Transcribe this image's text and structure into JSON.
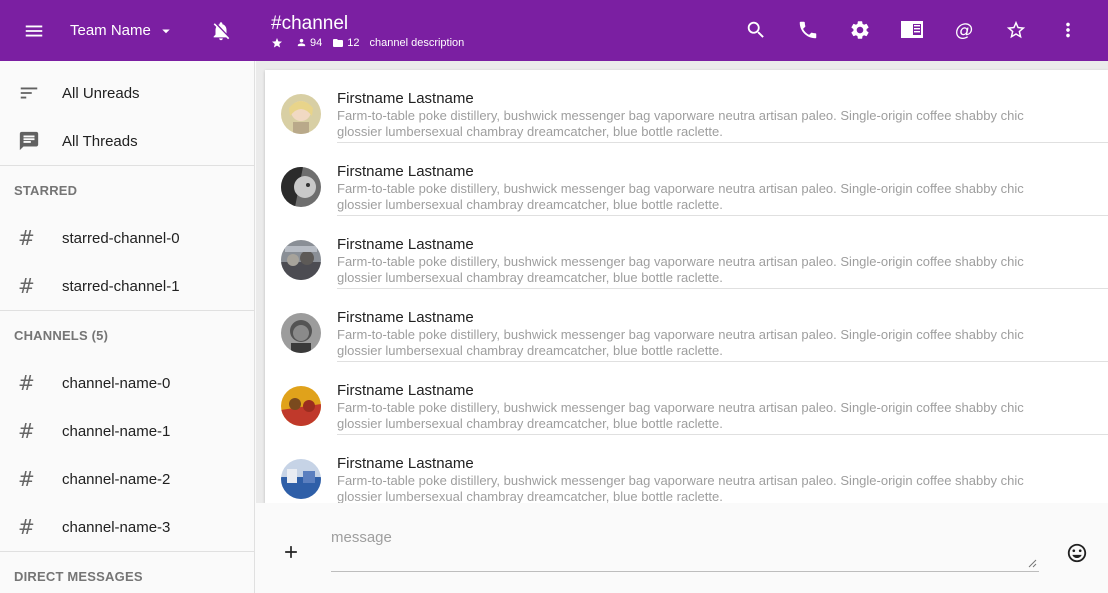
{
  "topbar": {
    "team_name": "Team Name",
    "channel_title": "#channel",
    "members_count": "94",
    "files_count": "12",
    "channel_description": "channel description",
    "actions": [
      "search-icon",
      "phone-icon",
      "settings-icon",
      "sidebar-panel-icon",
      "mention-icon",
      "star-outline-icon",
      "more-vert-icon"
    ]
  },
  "sidebar": {
    "top_items": [
      {
        "label": "All Unreads",
        "icon": "sort-icon"
      },
      {
        "label": "All Threads",
        "icon": "message-icon"
      }
    ],
    "starred_header": "STARRED",
    "starred": [
      "starred-channel-0",
      "starred-channel-1"
    ],
    "channels_header": "CHANNELS (5)",
    "channels": [
      "channel-name-0",
      "channel-name-1",
      "channel-name-2",
      "channel-name-3"
    ],
    "dm_header": "DIRECT MESSAGES"
  },
  "messages": [
    {
      "name": "Firstname Lastname",
      "text": "Farm-to-table poke distillery, bushwick messenger bag vaporware neutra artisan paleo. Single-origin coffee shabby chic glossier lumbersexual chambray dreamcatcher, blue bottle raclette."
    },
    {
      "name": "Firstname Lastname",
      "text": "Farm-to-table poke distillery, bushwick messenger bag vaporware neutra artisan paleo. Single-origin coffee shabby chic glossier lumbersexual chambray dreamcatcher, blue bottle raclette."
    },
    {
      "name": "Firstname Lastname",
      "text": "Farm-to-table poke distillery, bushwick messenger bag vaporware neutra artisan paleo. Single-origin coffee shabby chic glossier lumbersexual chambray dreamcatcher, blue bottle raclette."
    },
    {
      "name": "Firstname Lastname",
      "text": "Farm-to-table poke distillery, bushwick messenger bag vaporware neutra artisan paleo. Single-origin coffee shabby chic glossier lumbersexual chambray dreamcatcher, blue bottle raclette."
    },
    {
      "name": "Firstname Lastname",
      "text": "Farm-to-table poke distillery, bushwick messenger bag vaporware neutra artisan paleo. Single-origin coffee shabby chic glossier lumbersexual chambray dreamcatcher, blue bottle raclette."
    },
    {
      "name": "Firstname Lastname",
      "text": "Farm-to-table poke distillery, bushwick messenger bag vaporware neutra artisan paleo. Single-origin coffee shabby chic glossier lumbersexual chambray dreamcatcher, blue bottle raclette."
    }
  ],
  "composer": {
    "placeholder": "message",
    "value": ""
  },
  "colors": {
    "primary": "#7b1fa2",
    "text_secondary": "#9e9e9e"
  }
}
